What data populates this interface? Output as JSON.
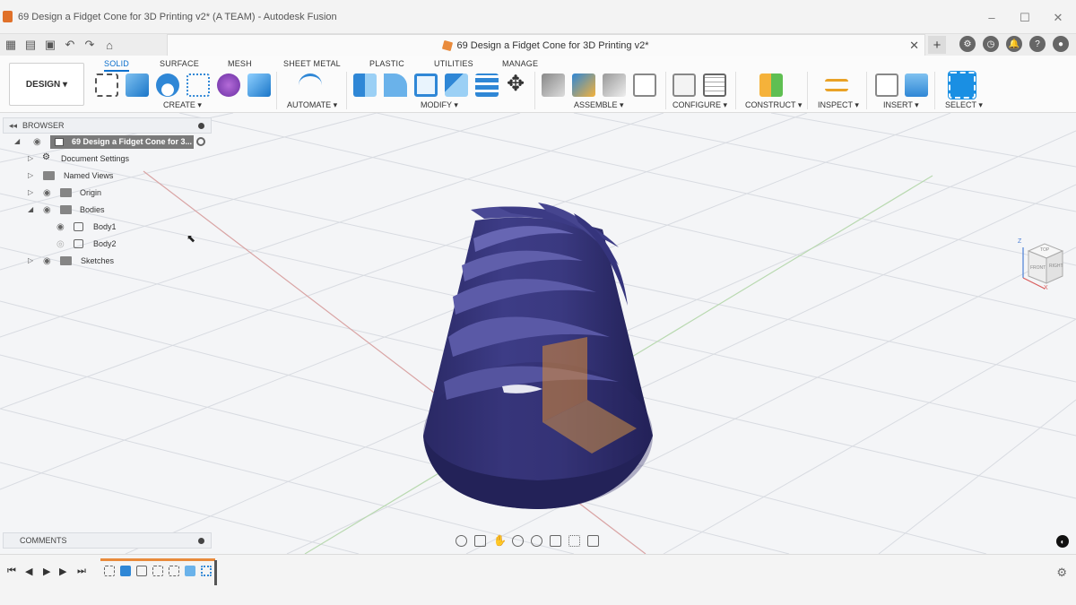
{
  "window": {
    "title": "69 Design a Fidget Cone for 3D Printing v2* (A TEAM) - Autodesk Fusion",
    "controls": [
      "–",
      "☐",
      "✕"
    ]
  },
  "document_tab": {
    "title": "69 Design a Fidget Cone for 3D Printing v2*",
    "close": "✕"
  },
  "workspace_button": "DESIGN ▾",
  "ribbon_tabs": [
    "SOLID",
    "SURFACE",
    "MESH",
    "SHEET METAL",
    "PLASTIC",
    "UTILITIES",
    "MANAGE"
  ],
  "active_tab": "SOLID",
  "tool_groups": [
    "CREATE ▾",
    "AUTOMATE ▾",
    "MODIFY ▾",
    "ASSEMBLE ▾",
    "CONFIGURE ▾",
    "CONSTRUCT ▾",
    "INSPECT ▾",
    "INSERT ▾",
    "SELECT ▾"
  ],
  "browser": {
    "header": "BROWSER",
    "root": "69 Design a Fidget Cone for 3...",
    "items": [
      {
        "label": "Document Settings"
      },
      {
        "label": "Named Views"
      },
      {
        "label": "Origin"
      },
      {
        "label": "Bodies"
      },
      {
        "label": "Body1"
      },
      {
        "label": "Body2"
      },
      {
        "label": "Sketches"
      }
    ]
  },
  "comments": {
    "label": "COMMENTS"
  },
  "viewcube": {
    "top": "TOP",
    "front": "FRONT",
    "right": "RIGHT",
    "axis_z": "Z",
    "axis_x": "X"
  },
  "colors": {
    "accent": "#0a6fcc",
    "model": "#2e2d6b",
    "grid": "#d3d6dc"
  }
}
